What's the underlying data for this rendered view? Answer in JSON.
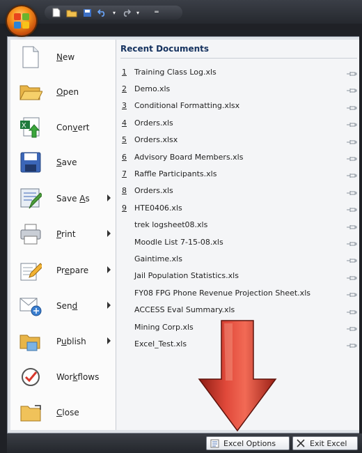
{
  "qat": {
    "icons": [
      "new-document-icon",
      "open-folder-icon",
      "save-disk-icon",
      "undo-icon",
      "redo-icon",
      "customize-qat-icon"
    ],
    "extra": "═"
  },
  "left_menu": {
    "items": [
      {
        "name": "new",
        "label": "New",
        "underline": "N",
        "submenu": false,
        "icon": "new-document-icon"
      },
      {
        "name": "open",
        "label": "Open",
        "underline": "O",
        "submenu": false,
        "icon": "open-folder-icon"
      },
      {
        "name": "convert",
        "label": "Convert",
        "underline": "v",
        "submenu": false,
        "icon": "convert-icon"
      },
      {
        "name": "save",
        "label": "Save",
        "underline": "S",
        "submenu": false,
        "icon": "save-disk-icon"
      },
      {
        "name": "save-as",
        "label": "Save As",
        "underline": "A",
        "submenu": true,
        "icon": "save-as-icon"
      },
      {
        "name": "print",
        "label": "Print",
        "underline": "P",
        "submenu": true,
        "icon": "printer-icon"
      },
      {
        "name": "prepare",
        "label": "Prepare",
        "underline": "e",
        "submenu": true,
        "icon": "prepare-pencil-icon"
      },
      {
        "name": "send",
        "label": "Send",
        "underline": "d",
        "submenu": true,
        "icon": "send-icon"
      },
      {
        "name": "publish",
        "label": "Publish",
        "underline": "u",
        "submenu": true,
        "icon": "publish-folder-icon"
      },
      {
        "name": "workflows",
        "label": "Workflows",
        "underline": "k",
        "submenu": false,
        "icon": "workflows-check-icon"
      },
      {
        "name": "close",
        "label": "Close",
        "underline": "C",
        "submenu": false,
        "icon": "close-folder-icon"
      }
    ]
  },
  "recent": {
    "header": "Recent Documents",
    "documents": [
      {
        "num": "1",
        "name": "Training Class Log.xls"
      },
      {
        "num": "2",
        "name": "Demo.xls"
      },
      {
        "num": "3",
        "name": "Conditional Formatting.xlsx"
      },
      {
        "num": "4",
        "name": "Orders.xls"
      },
      {
        "num": "5",
        "name": "Orders.xlsx"
      },
      {
        "num": "6",
        "name": "Advisory Board Members.xls"
      },
      {
        "num": "7",
        "name": "Raffle Participants.xls"
      },
      {
        "num": "8",
        "name": "Orders.xls"
      },
      {
        "num": "9",
        "name": "HTE0406.xls"
      },
      {
        "num": "",
        "name": "trek logsheet08.xls"
      },
      {
        "num": "",
        "name": "Moodle List 7-15-08.xls"
      },
      {
        "num": "",
        "name": "Gaintime.xls"
      },
      {
        "num": "",
        "name": "Jail Population Statistics.xls"
      },
      {
        "num": "",
        "name": "FY08 FPG Phone Revenue Projection Sheet.xls"
      },
      {
        "num": "",
        "name": "ACCESS Eval Summary.xls"
      },
      {
        "num": "",
        "name": "Mining Corp.xls"
      },
      {
        "num": "",
        "name": "Excel_Test.xls"
      }
    ]
  },
  "footer": {
    "excel_options": "Excel Options",
    "exit_excel": "Exit Excel"
  },
  "colors": {
    "accent_orange": "#f7941d",
    "arrow_red": "#d9372b",
    "header_blue": "#15325f"
  }
}
